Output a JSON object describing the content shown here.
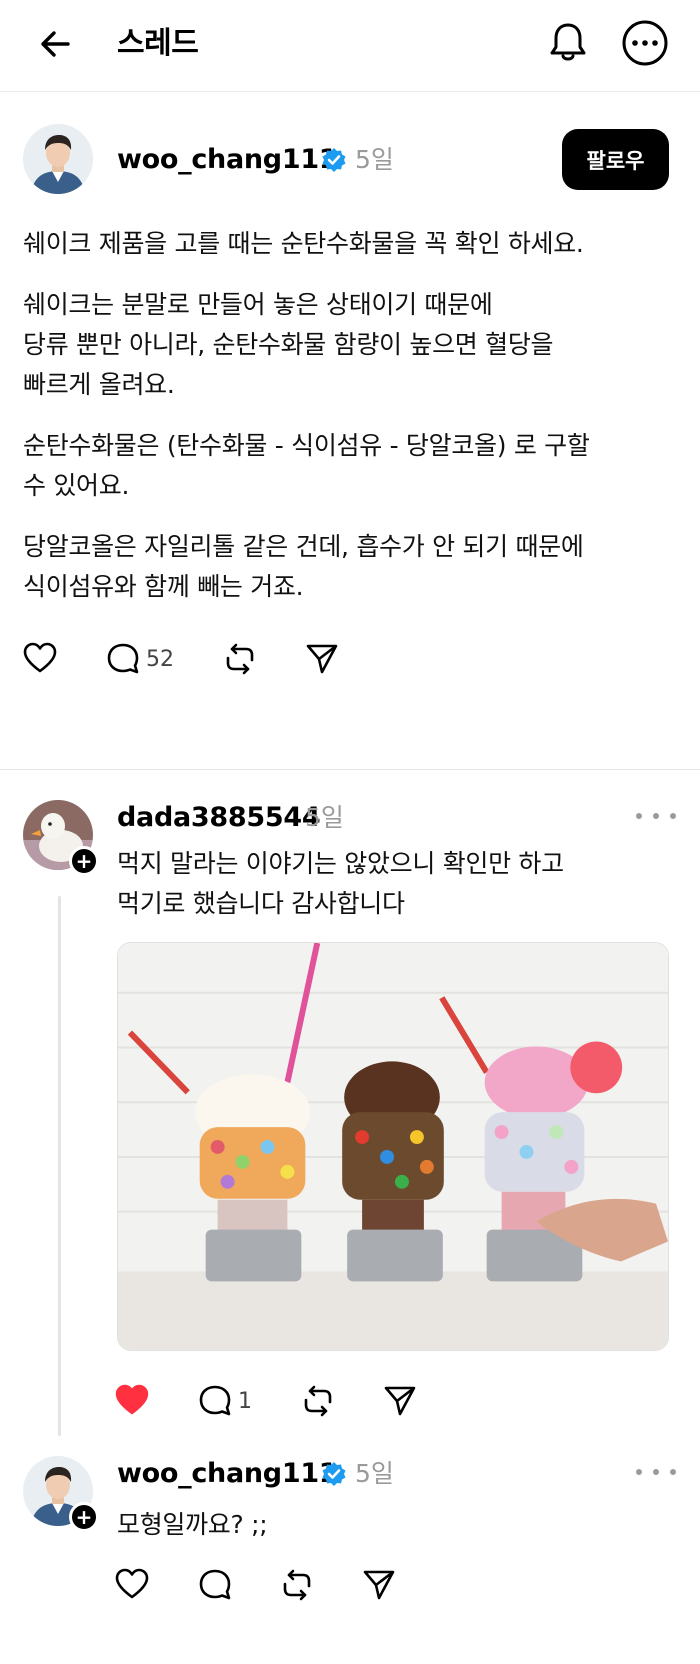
{
  "header": {
    "title": "스레드",
    "back_icon": "arrow-left-icon",
    "bell_icon": "bell-icon",
    "more_icon": "more-circle-icon"
  },
  "post": {
    "username": "woo_chang111",
    "time": "5일",
    "follow_label": "팔로우",
    "paragraphs": [
      "쉐이크 제품을 고를 때는 순탄수화물을 꼭 확인 하세요.",
      "쉐이크는 분말로 만들어 놓은 상태이기 때문에\n당류 뿐만 아니라, 순탄수화물 함량이 높으면 혈당을\n빠르게 올려요.",
      "순탄수화물은 (탄수화물 - 식이섬유 - 당알코올) 로 구할\n수 있어요.",
      "당알코올은 자일리톨 같은 건데, 흡수가 안 되기 때문에\n식이섬유와 함께 빼는 거죠."
    ],
    "reply_count": "52"
  },
  "reply1": {
    "username": "dada3885544",
    "time": "5일",
    "text": "먹지 말라는 이야기는 않았으니 확인만 하고\n먹기로 했습니다 감사합니다",
    "reply_count": "1",
    "liked": true
  },
  "reply2": {
    "username": "woo_chang111",
    "time": "5일",
    "text": "모형일까요? ;;"
  },
  "colors": {
    "verified": "#1d9bf0",
    "like_active": "#ff3040",
    "follow_bg": "#000000"
  }
}
